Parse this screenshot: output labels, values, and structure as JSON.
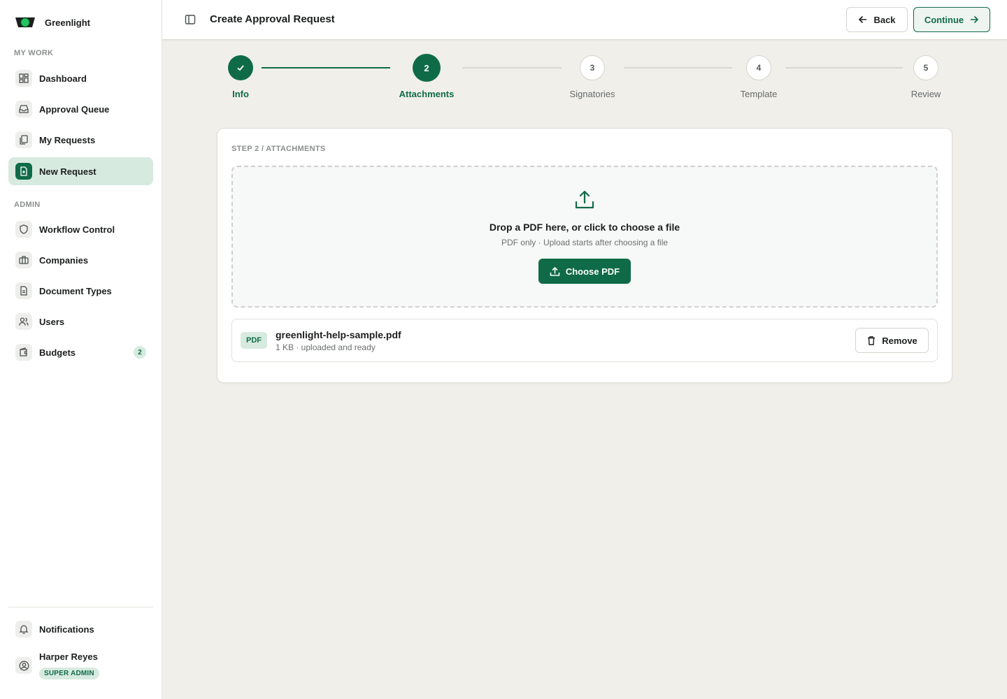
{
  "app": {
    "name": "Greenlight"
  },
  "sidebar": {
    "sections": {
      "my_work": "MY WORK",
      "admin": "ADMIN"
    },
    "my_work_items": [
      {
        "label": "Dashboard",
        "icon": "dashboard-icon"
      },
      {
        "label": "Approval Queue",
        "icon": "inbox-icon"
      },
      {
        "label": "My Requests",
        "icon": "files-icon"
      },
      {
        "label": "New Request",
        "icon": "file-plus-icon",
        "active": true
      }
    ],
    "admin_items": [
      {
        "label": "Workflow Control",
        "icon": "shield-icon"
      },
      {
        "label": "Companies",
        "icon": "briefcase-icon"
      },
      {
        "label": "Document Types",
        "icon": "document-icon"
      },
      {
        "label": "Users",
        "icon": "users-icon"
      },
      {
        "label": "Budgets",
        "icon": "wallet-icon",
        "badge": "2"
      }
    ],
    "notifications": {
      "label": "Notifications",
      "icon": "bell-icon"
    },
    "user": {
      "name": "Harper Reyes",
      "role": "SUPER ADMIN",
      "icon": "user-circle-icon"
    }
  },
  "header": {
    "title": "Create Approval Request",
    "back_label": "Back",
    "continue_label": "Continue"
  },
  "stepper": {
    "steps": [
      {
        "number": "1",
        "label": "Info",
        "state": "done"
      },
      {
        "number": "2",
        "label": "Attachments",
        "state": "current"
      },
      {
        "number": "3",
        "label": "Signatories",
        "state": "pending"
      },
      {
        "number": "4",
        "label": "Template",
        "state": "pending"
      },
      {
        "number": "5",
        "label": "Review",
        "state": "pending"
      }
    ]
  },
  "card": {
    "kicker": "STEP 2 / ATTACHMENTS",
    "dropzone": {
      "title": "Drop a PDF here, or click to choose a file",
      "subtitle": "PDF only · Upload starts after choosing a file",
      "button_label": "Choose PDF"
    },
    "file": {
      "type_chip": "PDF",
      "name": "greenlight-help-sample.pdf",
      "meta": "1 KB · uploaded and ready",
      "remove_label": "Remove"
    }
  },
  "colors": {
    "accent": "#0f6b47",
    "accent_light": "#d7eae0",
    "background": "#f0efea"
  }
}
